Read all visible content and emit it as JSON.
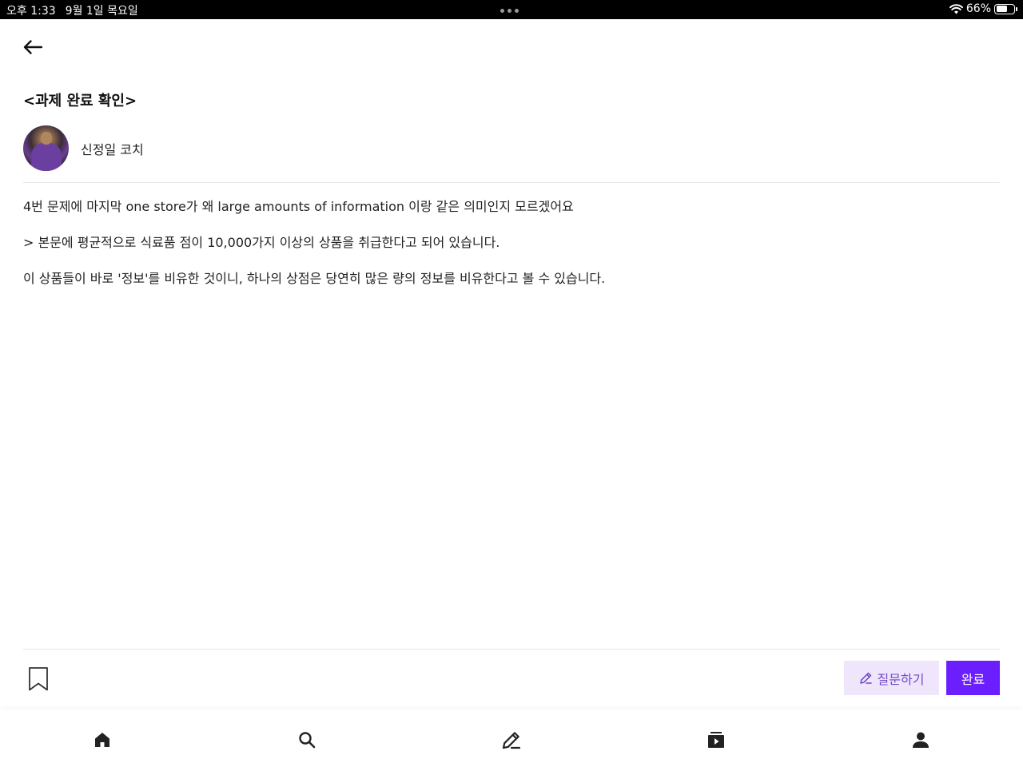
{
  "status_bar": {
    "time": "오후 1:33",
    "date": "9월 1일 목요일",
    "battery": "66%",
    "battery_level": 0.66
  },
  "post": {
    "title": "<과제 완료 확인>",
    "author": "신정일 코치",
    "lines": [
      "4번 문제에 마지막 one store가 왜 large amounts of information 이랑 같은 의미인지 모르겠어요",
      "> 본문에 평균적으로 식료품 점이 10,000가지 이상의 상품을 취급한다고 되어 있습니다.",
      "이 상품들이 바로 '정보'를 비유한 것이니, 하나의 상점은 당연히 많은 량의 정보를 비유한다고 볼 수 있습니다."
    ]
  },
  "actions": {
    "ask_label": "질문하기",
    "done_label": "완료"
  },
  "colors": {
    "accent": "#6b1fff",
    "ask_bg": "#efe6fc",
    "ask_text": "#6f47c7"
  },
  "tabbar": {
    "items": [
      "home-icon",
      "search-icon",
      "pencil-icon",
      "play-list-icon",
      "person-icon"
    ]
  }
}
